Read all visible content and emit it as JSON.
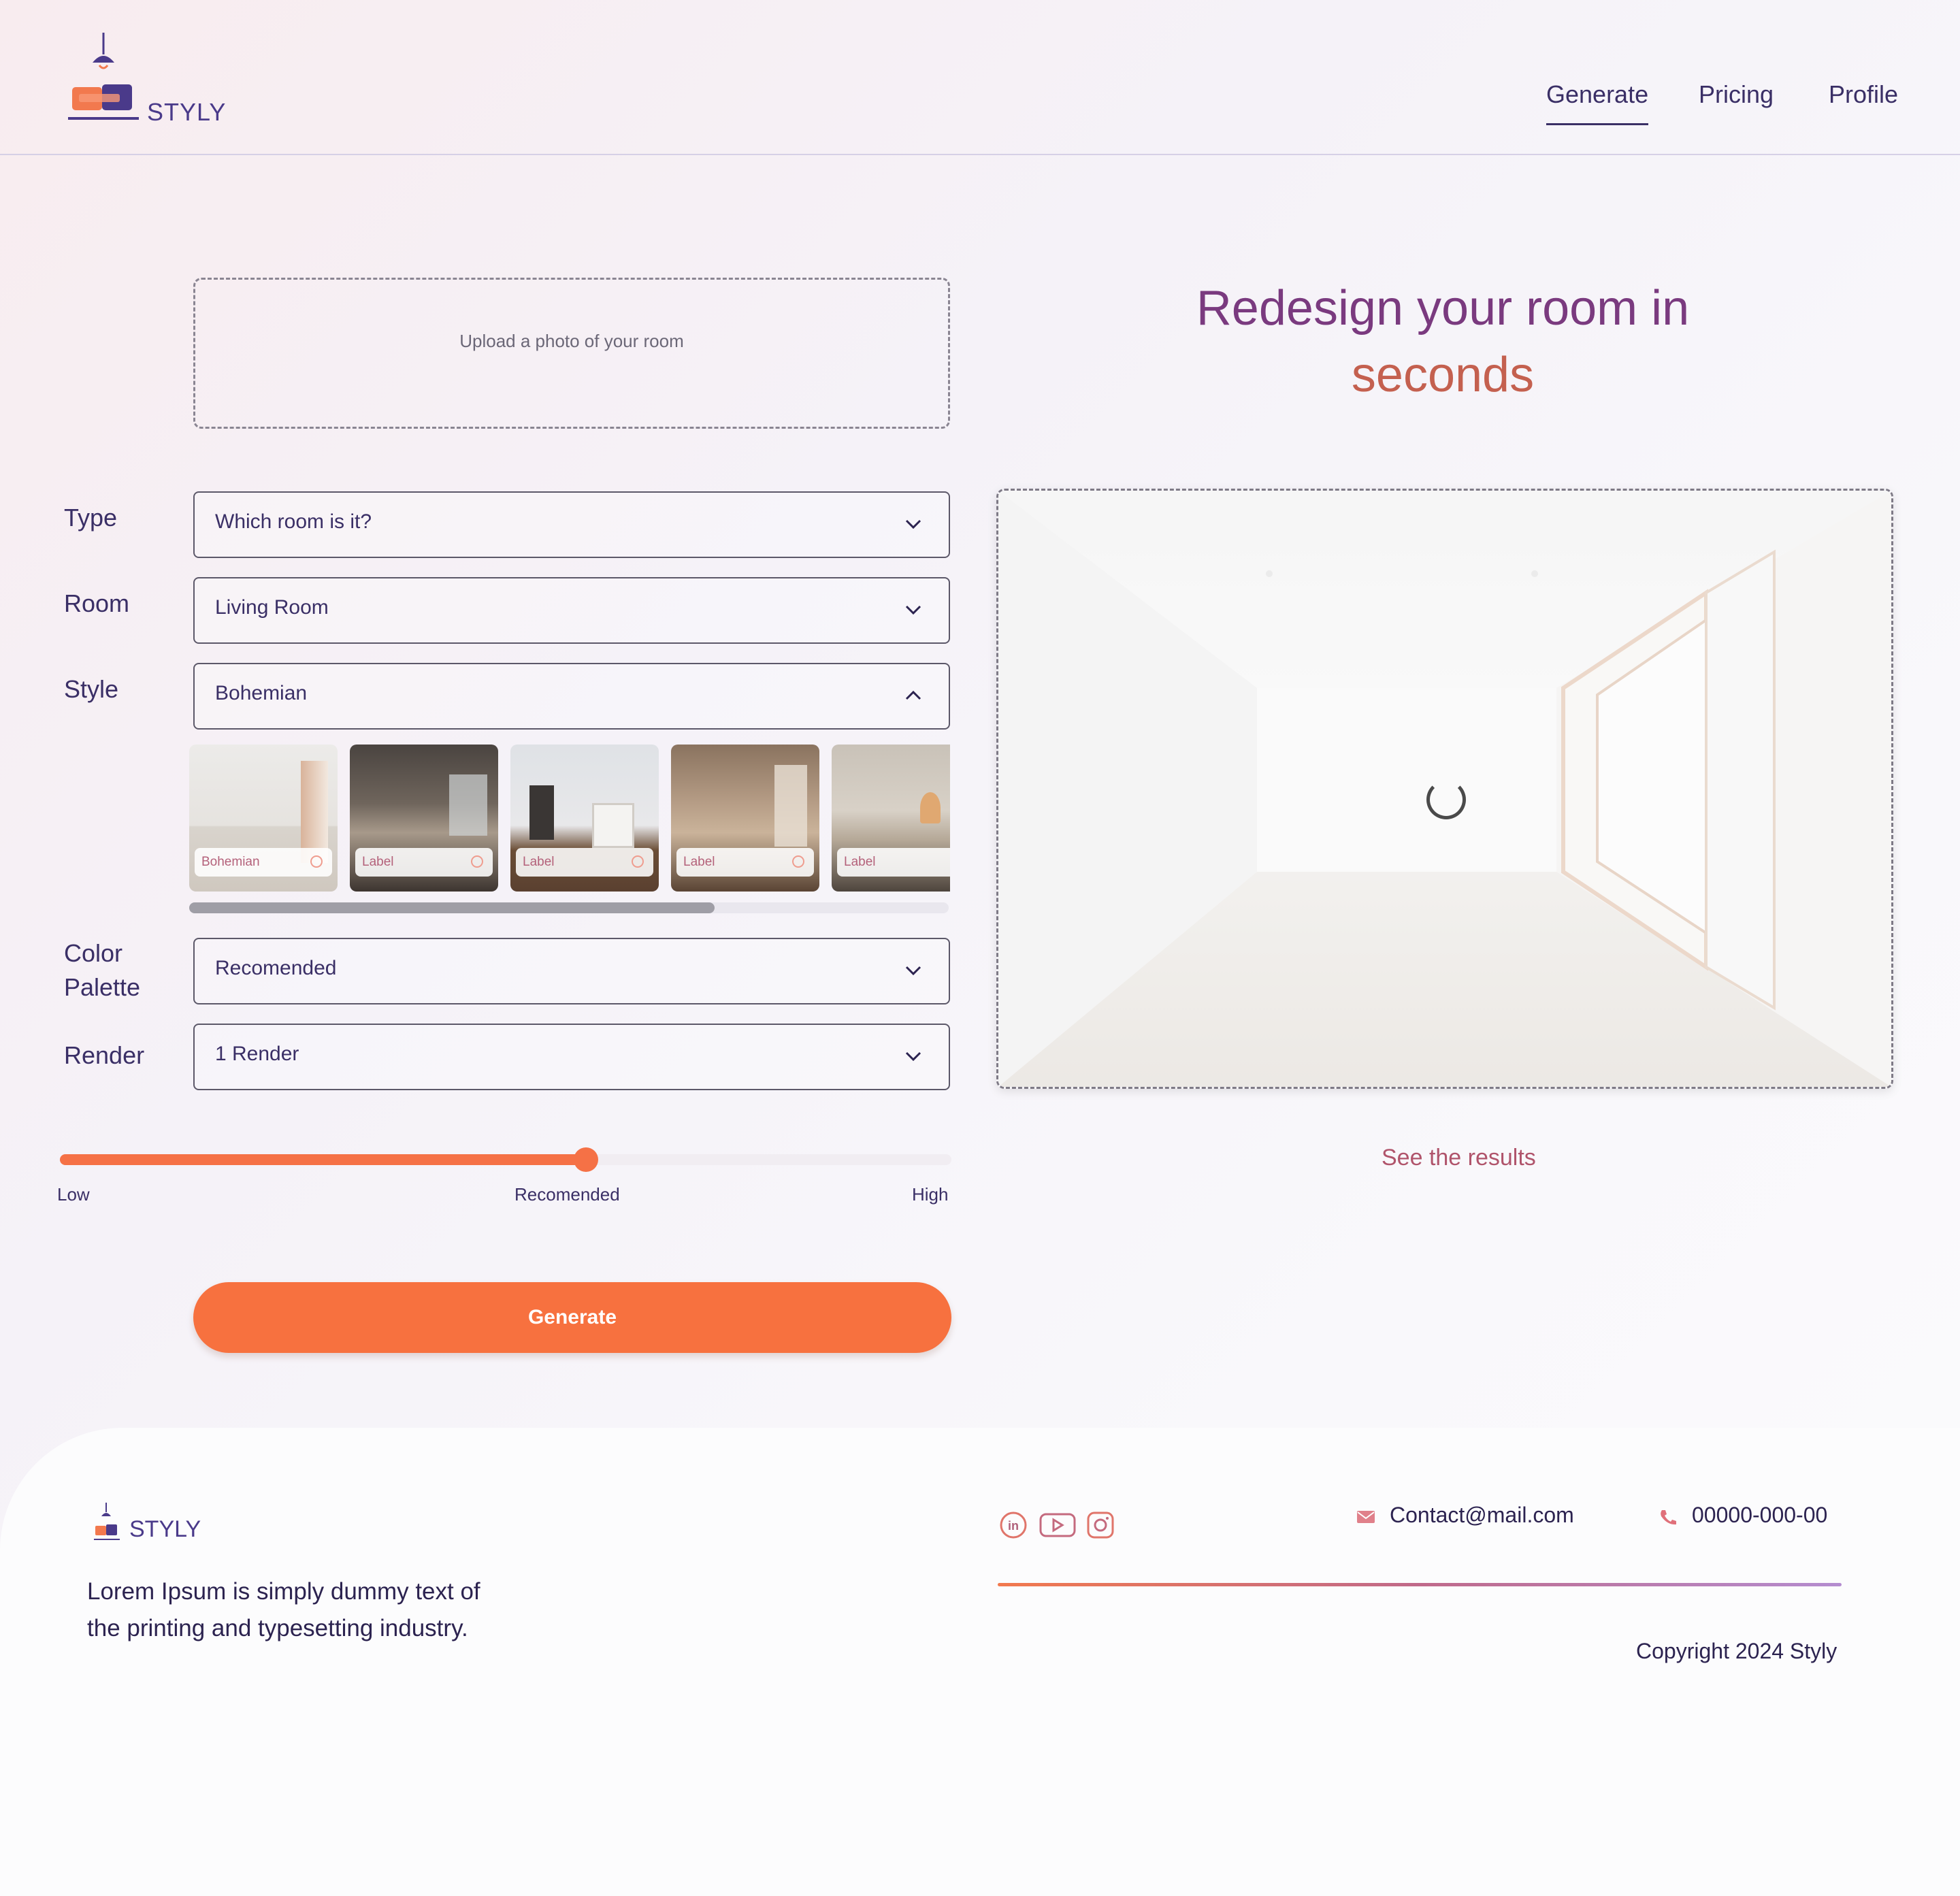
{
  "brand": {
    "name": "STYLY"
  },
  "nav": {
    "generate": "Generate",
    "pricing": "Pricing",
    "profile": "Profile",
    "active": "Generate"
  },
  "upload": {
    "placeholder": "Upload a photo of your room"
  },
  "headline": {
    "line1": "Redesign your room in",
    "line2": "seconds"
  },
  "form": {
    "type": {
      "label": "Type",
      "value": "Which room is it?"
    },
    "room": {
      "label": "Room",
      "value": "Living Room"
    },
    "style": {
      "label": "Style",
      "value": "Bohemian",
      "expanded": true
    },
    "palette": {
      "label_line1": "Color",
      "label_line2": "Palette",
      "value": "Recomended"
    },
    "render": {
      "label": "Render",
      "value": "1 Render"
    }
  },
  "style_options": [
    {
      "label": "Bohemian"
    },
    {
      "label": "Label"
    },
    {
      "label": "Label"
    },
    {
      "label": "Label"
    },
    {
      "label": "Label"
    }
  ],
  "slider": {
    "low": "Low",
    "mid": "Recomended",
    "high": "High",
    "value_fraction": 0.59
  },
  "actions": {
    "generate": "Generate"
  },
  "preview": {
    "status": "loading",
    "see_results": "See the results"
  },
  "footer": {
    "brand": "STYLY",
    "description_line1": "Lorem Ipsum is simply dummy text of",
    "description_line2": "the printing and typesetting industry.",
    "email": "Contact@mail.com",
    "phone": "00000-000-00",
    "copyright": "Copyright 2024 Styly",
    "social": [
      "linkedin-icon",
      "youtube-icon",
      "instagram-icon"
    ]
  },
  "colors": {
    "accent": "#f7713f",
    "brand_purple": "#4a3a8a",
    "headline_purple": "#7a3a7f",
    "headline_coral": "#c4604f"
  }
}
